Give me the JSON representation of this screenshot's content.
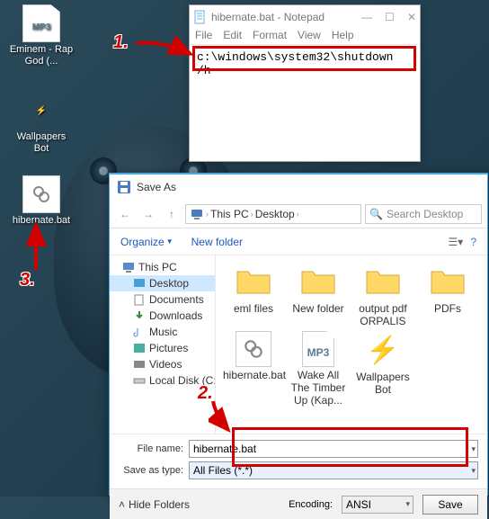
{
  "desktop": {
    "icons": [
      {
        "label": "Eminem - Rap God (...",
        "type": "mp3"
      },
      {
        "label": "Wallpapers Bot",
        "type": "purple"
      },
      {
        "label": "hibernate.bat",
        "type": "gear"
      }
    ]
  },
  "notepad": {
    "title": "hibernate.bat - Notepad",
    "menu": [
      "File",
      "Edit",
      "Format",
      "View",
      "Help"
    ],
    "content": "c:\\windows\\system32\\shutdown /h"
  },
  "saveas": {
    "title": "Save As",
    "breadcrumb": [
      "This PC",
      "Desktop"
    ],
    "search_placeholder": "Search Desktop",
    "toolbar": {
      "organize": "Organize",
      "newfolder": "New folder"
    },
    "tree": [
      {
        "label": "This PC",
        "icon": "pc",
        "indent": 0
      },
      {
        "label": "Desktop",
        "icon": "desktop",
        "indent": 1,
        "selected": true
      },
      {
        "label": "Documents",
        "icon": "folder",
        "indent": 1
      },
      {
        "label": "Downloads",
        "icon": "folder",
        "indent": 1
      },
      {
        "label": "Music",
        "icon": "folder",
        "indent": 1
      },
      {
        "label": "Pictures",
        "icon": "folder",
        "indent": 1
      },
      {
        "label": "Videos",
        "icon": "folder",
        "indent": 1
      },
      {
        "label": "Local Disk (C:)",
        "icon": "disk",
        "indent": 1
      }
    ],
    "files": [
      {
        "label": "eml files",
        "type": "folder"
      },
      {
        "label": "New folder",
        "type": "folder"
      },
      {
        "label": "output pdf ORPALIS",
        "type": "folder"
      },
      {
        "label": "PDFs",
        "type": "folder"
      },
      {
        "label": "hibernate.bat",
        "type": "gear"
      },
      {
        "label": "Wake All The Timber Up (Kap...",
        "type": "mp3"
      },
      {
        "label": "Wallpapers Bot",
        "type": "purple"
      }
    ],
    "filename_label": "File name:",
    "filename_value": "hibernate.bat",
    "saveastype_label": "Save as type:",
    "saveastype_value": "All Files  (*.*)",
    "hide_folders": "Hide Folders",
    "encoding_label": "Encoding:",
    "encoding_value": "ANSI",
    "save_btn": "Save"
  },
  "callouts": {
    "one": "1.",
    "two": "2.",
    "three": "3."
  }
}
